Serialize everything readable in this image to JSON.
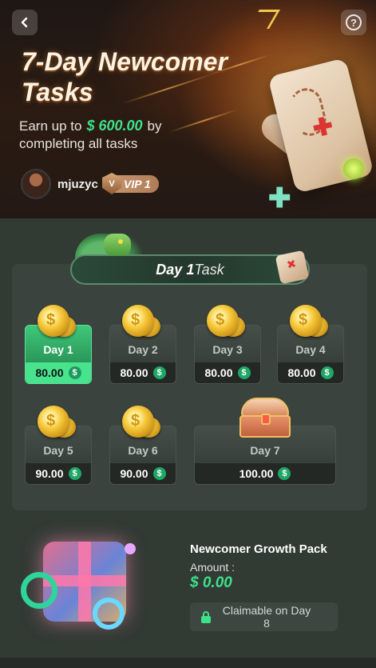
{
  "header": {
    "title": "7-Day Newcomer Tasks",
    "subtitle_prefix": "Earn up to",
    "subtitle_amount": "$ 600.00",
    "subtitle_suffix": "by completing all tasks",
    "help_symbol": "?"
  },
  "user": {
    "username": "mjuzyc",
    "vip_label": "VIP 1",
    "vip_shield": "V"
  },
  "banner": {
    "day": "Day 1",
    "task": "Task"
  },
  "days": [
    {
      "label": "Day 1",
      "reward": "80.00",
      "active": true
    },
    {
      "label": "Day 2",
      "reward": "80.00",
      "active": false
    },
    {
      "label": "Day 3",
      "reward": "80.00",
      "active": false
    },
    {
      "label": "Day 4",
      "reward": "80.00",
      "active": false
    },
    {
      "label": "Day 5",
      "reward": "90.00",
      "active": false
    },
    {
      "label": "Day 6",
      "reward": "90.00",
      "active": false
    },
    {
      "label": "Day 7",
      "reward": "100.00",
      "active": false
    }
  ],
  "currency_symbol": "$",
  "growth_pack": {
    "title": "Newcomer Growth Pack",
    "amount_label": "Amount :",
    "amount": "$ 0.00",
    "claim_label": "Claimable on Day 8"
  },
  "colors": {
    "accent_green": "#3ee08a",
    "active_day": "#40c77a",
    "vip_badge": "#c89870"
  },
  "icons": {
    "back": "chevron-left-icon",
    "help": "question-circle-icon",
    "lock": "lock-icon",
    "coin": "dollar-coin-icon"
  }
}
